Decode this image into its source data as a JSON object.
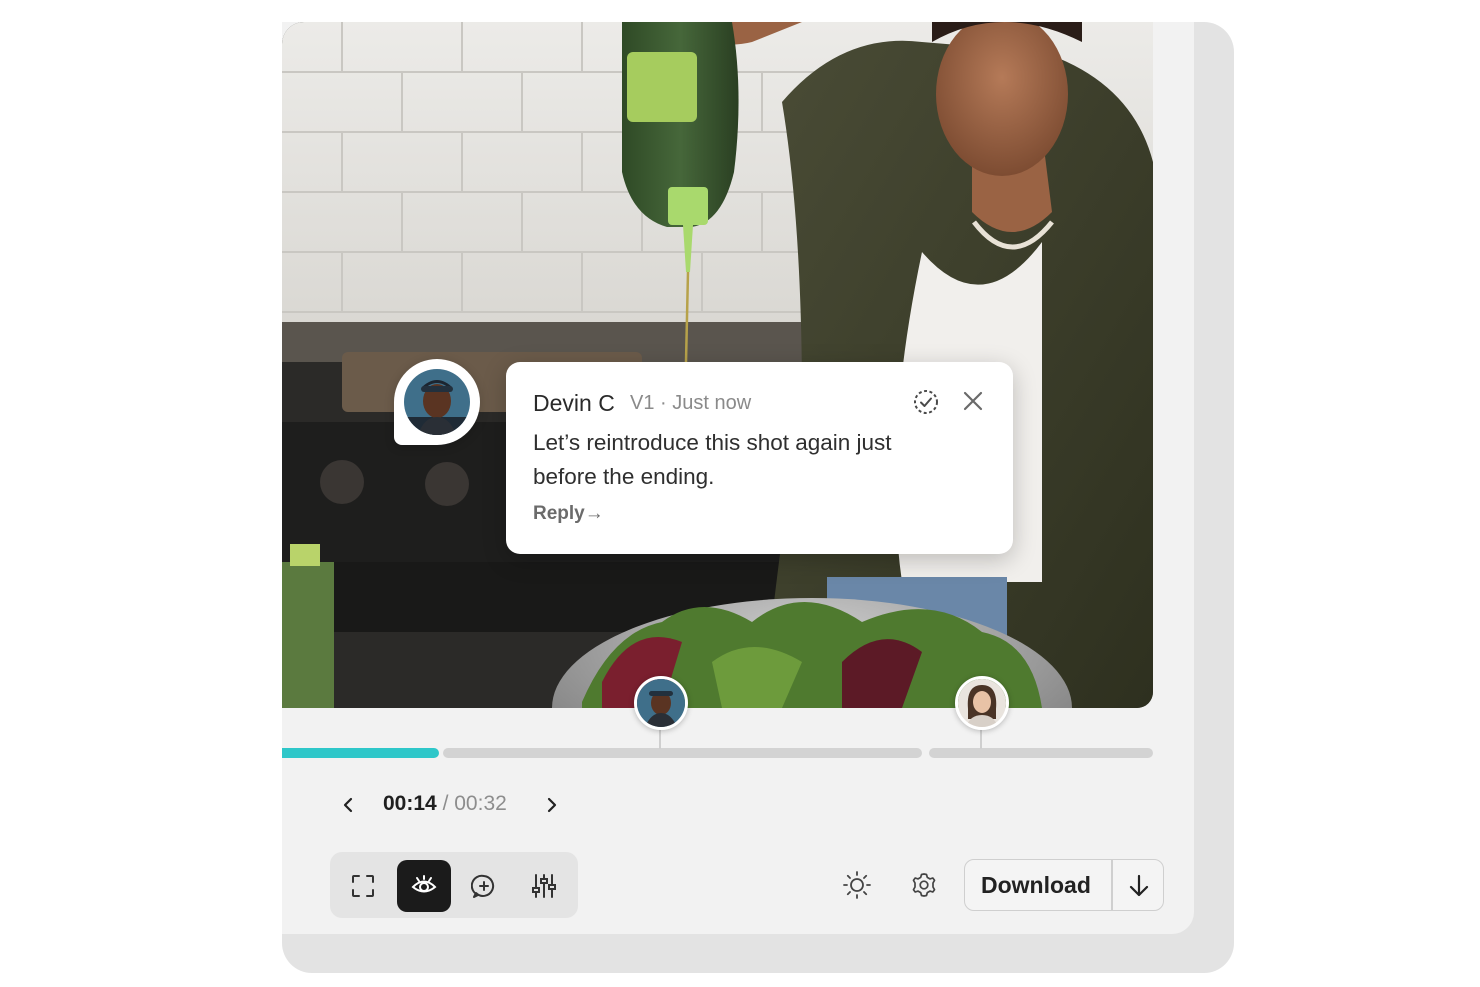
{
  "comment": {
    "author": "Devin C",
    "meta": "V1 · Just now",
    "body": "Let’s reintroduce this shot again just before the ending.",
    "reply_label": "Reply",
    "reply_arrow": "→",
    "resolve_icon": "resolve-check-icon",
    "close_icon": "close-icon"
  },
  "timeline": {
    "progress_fraction": 0.18,
    "markers": [
      {
        "name": "comment-marker-devin",
        "avatar": "person-avatar"
      },
      {
        "name": "comment-marker-woman",
        "avatar": "person-avatar"
      }
    ]
  },
  "playback": {
    "current_time": "00:14",
    "separator": "/",
    "total_time": "00:32",
    "prev_icon": "chevron-left-icon",
    "next_icon": "chevron-right-icon"
  },
  "toolbar": {
    "tools": [
      {
        "icon": "fullscreen-icon",
        "active": false
      },
      {
        "icon": "eye-icon",
        "active": true
      },
      {
        "icon": "add-comment-icon",
        "active": false
      },
      {
        "icon": "sliders-icon",
        "active": false
      }
    ],
    "brightness_icon": "sun-icon",
    "settings_icon": "gear-icon",
    "download_label": "Download",
    "download_icon": "arrow-down-icon"
  },
  "colors": {
    "accent": "#2ec7c9",
    "active_tool": "#1b1b1b",
    "track": "#d3d3d3"
  }
}
